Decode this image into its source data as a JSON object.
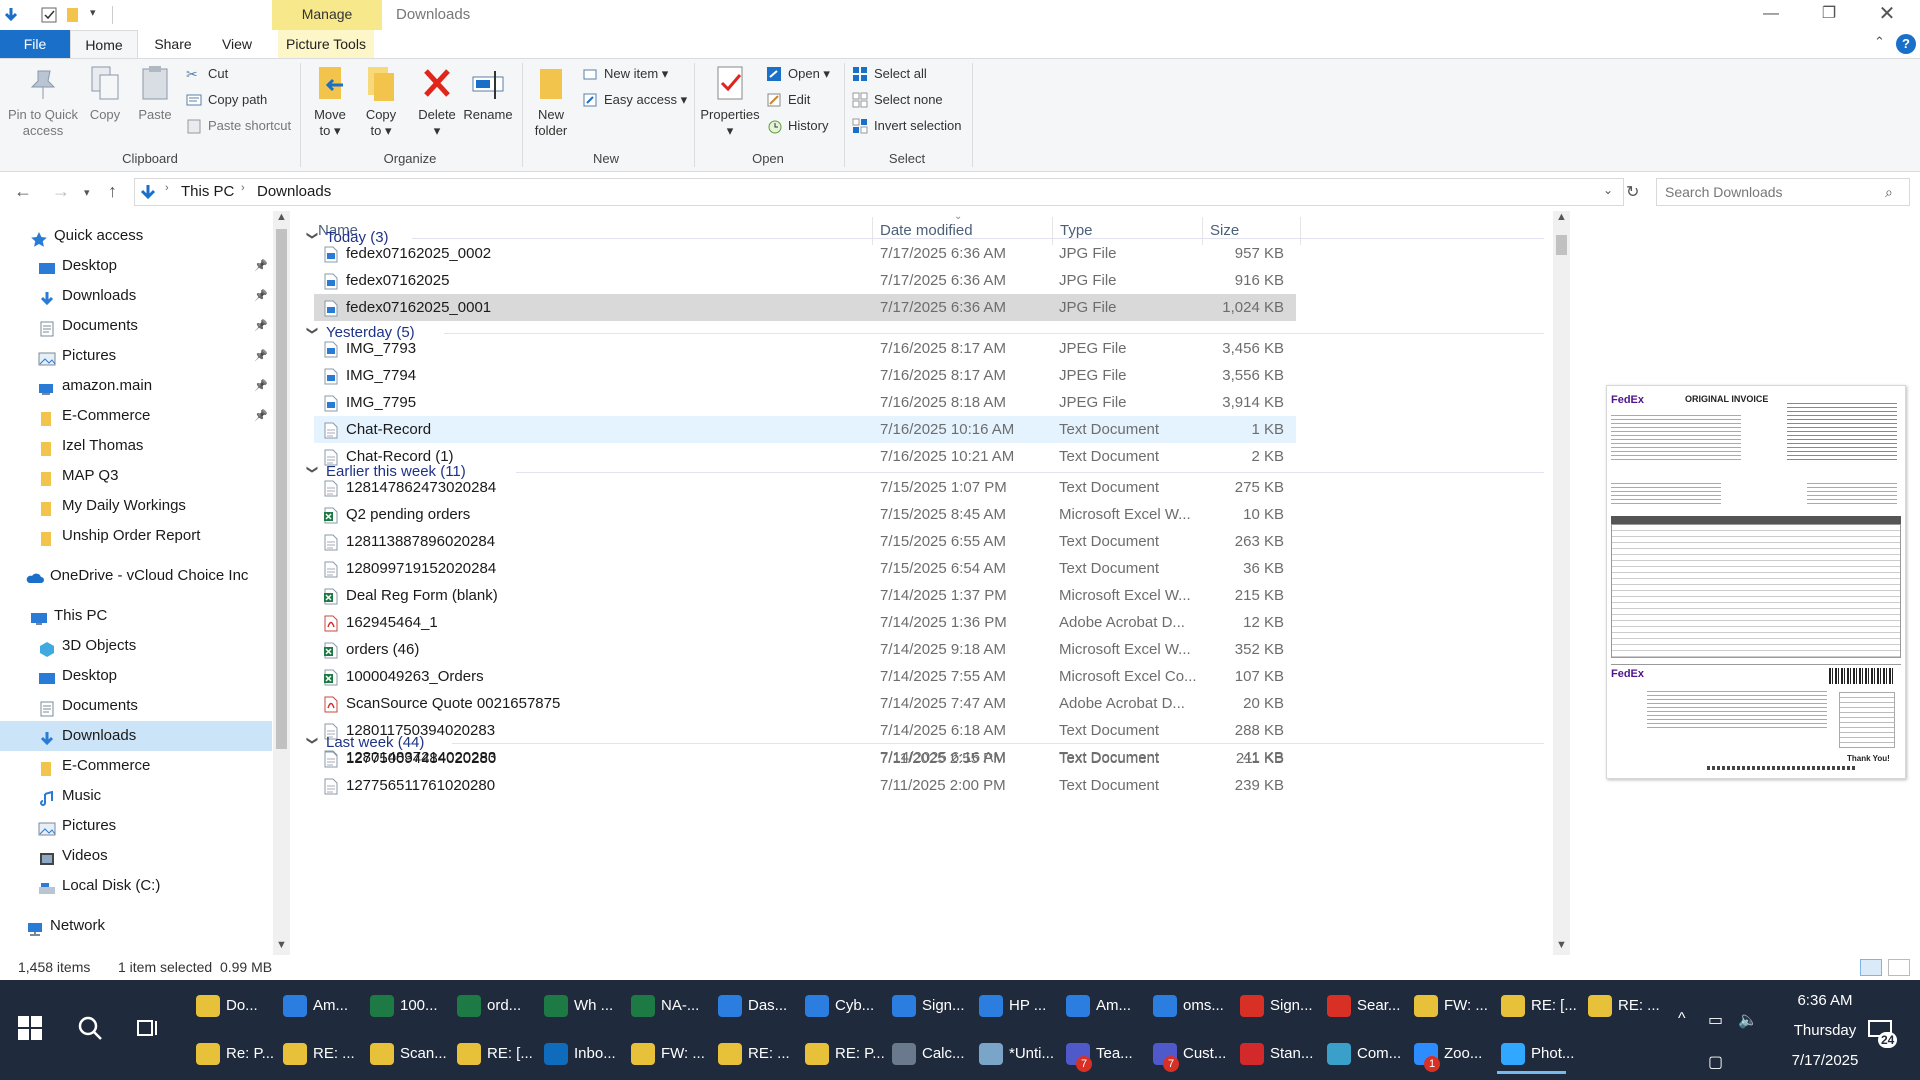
{
  "window": {
    "manage_tab": "Manage",
    "title": "Downloads"
  },
  "tabs": {
    "file": "File",
    "home": "Home",
    "share": "Share",
    "view": "View",
    "picture_tools": "Picture Tools"
  },
  "ribbon": {
    "clipboard": {
      "pin": "Pin to Quick",
      "pin2": "access",
      "copy": "Copy",
      "paste": "Paste",
      "cut": "Cut",
      "copy_path": "Copy path",
      "paste_shortcut": "Paste shortcut",
      "label": "Clipboard"
    },
    "organize": {
      "move": "Move",
      "move2": "to",
      "copy": "Copy",
      "copy2": "to",
      "delete": "Delete",
      "rename": "Rename",
      "label": "Organize"
    },
    "new": {
      "new_folder": "New",
      "new_folder2": "folder",
      "new_item": "New item",
      "easy_access": "Easy access",
      "label": "New"
    },
    "open": {
      "properties": "Properties",
      "open": "Open",
      "edit": "Edit",
      "history": "History",
      "label": "Open"
    },
    "select": {
      "select_all": "Select all",
      "select_none": "Select none",
      "invert": "Invert selection",
      "label": "Select"
    }
  },
  "address": {
    "crumb1": "This PC",
    "crumb2": "Downloads",
    "search_placeholder": "Search Downloads"
  },
  "nav": {
    "quick_access": "Quick access",
    "quick": [
      {
        "label": "Desktop",
        "pinned": true
      },
      {
        "label": "Downloads",
        "pinned": true
      },
      {
        "label": "Documents",
        "pinned": true
      },
      {
        "label": "Pictures",
        "pinned": true
      },
      {
        "label": "amazon.main",
        "pinned": true
      },
      {
        "label": "E-Commerce",
        "pinned": true
      },
      {
        "label": "Izel Thomas",
        "pinned": false
      },
      {
        "label": "MAP Q3",
        "pinned": false
      },
      {
        "label": "My Daily Workings",
        "pinned": false
      },
      {
        "label": "Unship Order Report",
        "pinned": false
      }
    ],
    "onedrive": "OneDrive - vCloud Choice Inc",
    "this_pc": "This PC",
    "pc": [
      "3D Objects",
      "Desktop",
      "Documents",
      "Downloads",
      "E-Commerce",
      "Music",
      "Pictures",
      "Videos",
      "Local Disk (C:)"
    ],
    "network": "Network"
  },
  "columns": {
    "name": "Name",
    "date": "Date modified",
    "type": "Type",
    "size": "Size"
  },
  "groups": [
    {
      "title": "Today (3)",
      "rows": [
        {
          "name": "fedex07162025_0002",
          "date": "7/17/2025 6:36 AM",
          "type": "JPG File",
          "size": "957 KB",
          "icon": "image"
        },
        {
          "name": "fedex07162025",
          "date": "7/17/2025 6:36 AM",
          "type": "JPG File",
          "size": "916 KB",
          "icon": "image"
        },
        {
          "name": "fedex07162025_0001",
          "date": "7/17/2025 6:36 AM",
          "type": "JPG File",
          "size": "1,024 KB",
          "icon": "image"
        }
      ]
    },
    {
      "title": "Yesterday (5)",
      "rows": [
        {
          "name": "IMG_7793",
          "date": "7/16/2025 8:17 AM",
          "type": "JPEG File",
          "size": "3,456 KB",
          "icon": "image"
        },
        {
          "name": "IMG_7794",
          "date": "7/16/2025 8:17 AM",
          "type": "JPEG File",
          "size": "3,556 KB",
          "icon": "image"
        },
        {
          "name": "IMG_7795",
          "date": "7/16/2025 8:18 AM",
          "type": "JPEG File",
          "size": "3,914 KB",
          "icon": "image"
        },
        {
          "name": "Chat-Record",
          "date": "7/16/2025 10:16 AM",
          "type": "Text Document",
          "size": "1 KB",
          "icon": "text"
        },
        {
          "name": "Chat-Record (1)",
          "date": "7/16/2025 10:21 AM",
          "type": "Text Document",
          "size": "2 KB",
          "icon": "text"
        }
      ]
    },
    {
      "title": "Earlier this week (11)",
      "rows": [
        {
          "name": "128147862473020284",
          "date": "7/15/2025 1:07 PM",
          "type": "Text Document",
          "size": "275 KB",
          "icon": "text"
        },
        {
          "name": "Q2 pending orders",
          "date": "7/15/2025 8:45 AM",
          "type": "Microsoft Excel W...",
          "size": "10 KB",
          "icon": "excel"
        },
        {
          "name": "128113887896020284",
          "date": "7/15/2025 6:55 AM",
          "type": "Text Document",
          "size": "263 KB",
          "icon": "text"
        },
        {
          "name": "128099719152020284",
          "date": "7/15/2025 6:54 AM",
          "type": "Text Document",
          "size": "36 KB",
          "icon": "text"
        },
        {
          "name": "Deal Reg Form (blank)",
          "date": "7/14/2025 1:37 PM",
          "type": "Microsoft Excel W...",
          "size": "215 KB",
          "icon": "excel"
        },
        {
          "name": "162945464_1",
          "date": "7/14/2025 1:36 PM",
          "type": "Adobe Acrobat D...",
          "size": "12 KB",
          "icon": "pdf"
        },
        {
          "name": "orders (46)",
          "date": "7/14/2025 9:18 AM",
          "type": "Microsoft Excel W...",
          "size": "352 KB",
          "icon": "excel"
        },
        {
          "name": "1000049263_Orders",
          "date": "7/14/2025 7:55 AM",
          "type": "Microsoft Excel Co...",
          "size": "107 KB",
          "icon": "excel"
        },
        {
          "name": "ScanSource Quote 0021657875",
          "date": "7/14/2025 7:47 AM",
          "type": "Adobe Acrobat D...",
          "size": "20 KB",
          "icon": "pdf"
        },
        {
          "name": "128011750394020283",
          "date": "7/14/2025 6:18 AM",
          "type": "Text Document",
          "size": "288 KB",
          "icon": "text"
        },
        {
          "name": "128014837214020283",
          "date": "7/14/2025 6:16 AM",
          "type": "Text Document",
          "size": "41 KB",
          "icon": "text"
        }
      ]
    },
    {
      "title": "Last week (44)",
      "rows": [
        {
          "name": "127750094484020280",
          "date": "7/11/2025 2:55 PM",
          "type": "Text Document",
          "size": "211 KB",
          "icon": "text"
        },
        {
          "name": "127756511761020280",
          "date": "7/11/2025 2:00 PM",
          "type": "Text Document",
          "size": "239 KB",
          "icon": "text"
        }
      ]
    }
  ],
  "preview": {
    "brand": "FedEx",
    "heading": "ORIGINAL INVOICE",
    "brand2": "FedEx",
    "thanks": "Thank You!"
  },
  "status": {
    "items": "1,458 items",
    "selected": "1 item selected  0.99 MB"
  },
  "taskbar": {
    "row1": [
      "Do...",
      "Am...",
      "100...",
      "ord...",
      "Wh ...",
      "NA-...",
      "Das...",
      "Cyb...",
      "Sign...",
      "HP ...",
      "Am...",
      "oms...",
      "Sign...",
      "Sear...",
      "FW: ...",
      "RE: [...",
      "RE: ..."
    ],
    "row2": [
      "Re: P...",
      "RE: ...",
      "Scan...",
      "RE: [...",
      "Inbo...",
      "FW: ...",
      "RE: ...",
      "RE: P...",
      "Calc...",
      "*Unti...",
      "Tea...",
      "Cust...",
      "Stan...",
      "Com...",
      "Zoo...",
      "Phot..."
    ],
    "time": "6:36 AM",
    "day": "Thursday",
    "date": "7/17/2025",
    "notif_count": "24",
    "badge7a": "7",
    "badge7b": "7",
    "badge1": "1",
    "colors": {
      "bg": "#1f2a3c",
      "accent": "#76b9ed"
    }
  }
}
